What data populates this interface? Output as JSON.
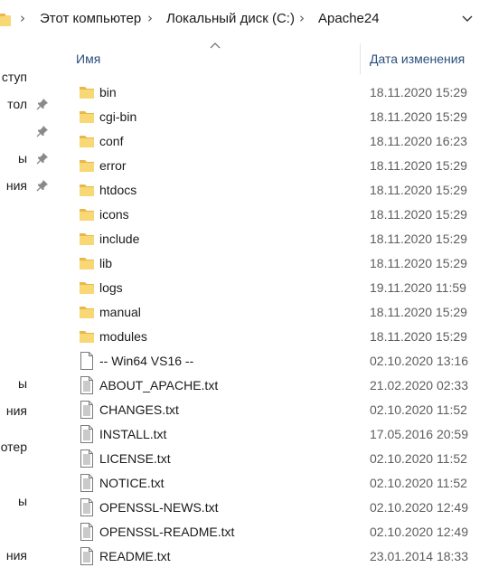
{
  "breadcrumb": [
    "Этот компьютер",
    "Локальный диск (C:)",
    "Apache24"
  ],
  "nav_items": [
    {
      "label": "ступ",
      "pinned": false
    },
    {
      "label": "тол",
      "pinned": true
    },
    {
      "label": "",
      "pinned": true
    },
    {
      "label": "ы",
      "pinned": true
    },
    {
      "label": "ния",
      "pinned": true
    },
    {
      "label": "ы",
      "pinned": false
    },
    {
      "label": "ния",
      "pinned": false
    },
    {
      "label": "отер",
      "pinned": false
    },
    {
      "label": "ы",
      "pinned": false
    },
    {
      "label": "ния",
      "pinned": false
    }
  ],
  "columns": {
    "name": "Имя",
    "date": "Дата изменения"
  },
  "files": [
    {
      "name": "bin",
      "date": "18.11.2020 15:29",
      "type": "folder"
    },
    {
      "name": "cgi-bin",
      "date": "18.11.2020 15:29",
      "type": "folder"
    },
    {
      "name": "conf",
      "date": "18.11.2020 16:23",
      "type": "folder"
    },
    {
      "name": "error",
      "date": "18.11.2020 15:29",
      "type": "folder"
    },
    {
      "name": "htdocs",
      "date": "18.11.2020 15:29",
      "type": "folder"
    },
    {
      "name": "icons",
      "date": "18.11.2020 15:29",
      "type": "folder"
    },
    {
      "name": "include",
      "date": "18.11.2020 15:29",
      "type": "folder"
    },
    {
      "name": "lib",
      "date": "18.11.2020 15:29",
      "type": "folder"
    },
    {
      "name": "logs",
      "date": "19.11.2020 11:59",
      "type": "folder"
    },
    {
      "name": "manual",
      "date": "18.11.2020 15:29",
      "type": "folder"
    },
    {
      "name": "modules",
      "date": "18.11.2020 15:29",
      "type": "folder"
    },
    {
      "name": "-- Win64 VS16  --",
      "date": "02.10.2020 13:16",
      "type": "file"
    },
    {
      "name": "ABOUT_APACHE.txt",
      "date": "21.02.2020 02:33",
      "type": "text"
    },
    {
      "name": "CHANGES.txt",
      "date": "02.10.2020 11:52",
      "type": "text"
    },
    {
      "name": "INSTALL.txt",
      "date": "17.05.2016 20:59",
      "type": "text"
    },
    {
      "name": "LICENSE.txt",
      "date": "02.10.2020 11:52",
      "type": "text"
    },
    {
      "name": "NOTICE.txt",
      "date": "02.10.2020 11:52",
      "type": "text"
    },
    {
      "name": "OPENSSL-NEWS.txt",
      "date": "02.10.2020 12:49",
      "type": "text"
    },
    {
      "name": "OPENSSL-README.txt",
      "date": "02.10.2020 12:49",
      "type": "text"
    },
    {
      "name": "README.txt",
      "date": "23.01.2014 18:33",
      "type": "text"
    }
  ],
  "colors": {
    "folder": "#f8d775",
    "folder_dark": "#e8b84a",
    "header_text": "#2b4f7e",
    "date_text": "#5d5d5d"
  },
  "icons": {
    "folder": "folder-icon",
    "file": "blank-file-icon",
    "text": "text-file-icon",
    "pin": "pin-icon",
    "dropdown": "chevron-down-icon",
    "sort": "sort-ascending-icon"
  }
}
